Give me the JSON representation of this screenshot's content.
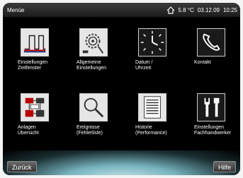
{
  "status": {
    "title": "Menüe",
    "temperature": "5.8 °C",
    "date": "03.12.09",
    "time": "10:25"
  },
  "tiles": [
    {
      "line1": "Einstellungen",
      "line2": "Zeitfenster"
    },
    {
      "line1": "Allgemeine",
      "line2": "Einstellungen"
    },
    {
      "line1": "Datum /",
      "line2": "Uhrzeit"
    },
    {
      "line1": "Kontakt",
      "line2": ""
    },
    {
      "line1": "Anlagen",
      "line2": "Übersicht"
    },
    {
      "line1": "Ereignisse",
      "line2": "(Fehlerliste)"
    },
    {
      "line1": "Historie",
      "line2": "(Performance)"
    },
    {
      "line1": "Einstellungen",
      "line2": "Fachhandwerker"
    }
  ],
  "buttons": {
    "back": "Zurück",
    "help": "Hilfe"
  }
}
